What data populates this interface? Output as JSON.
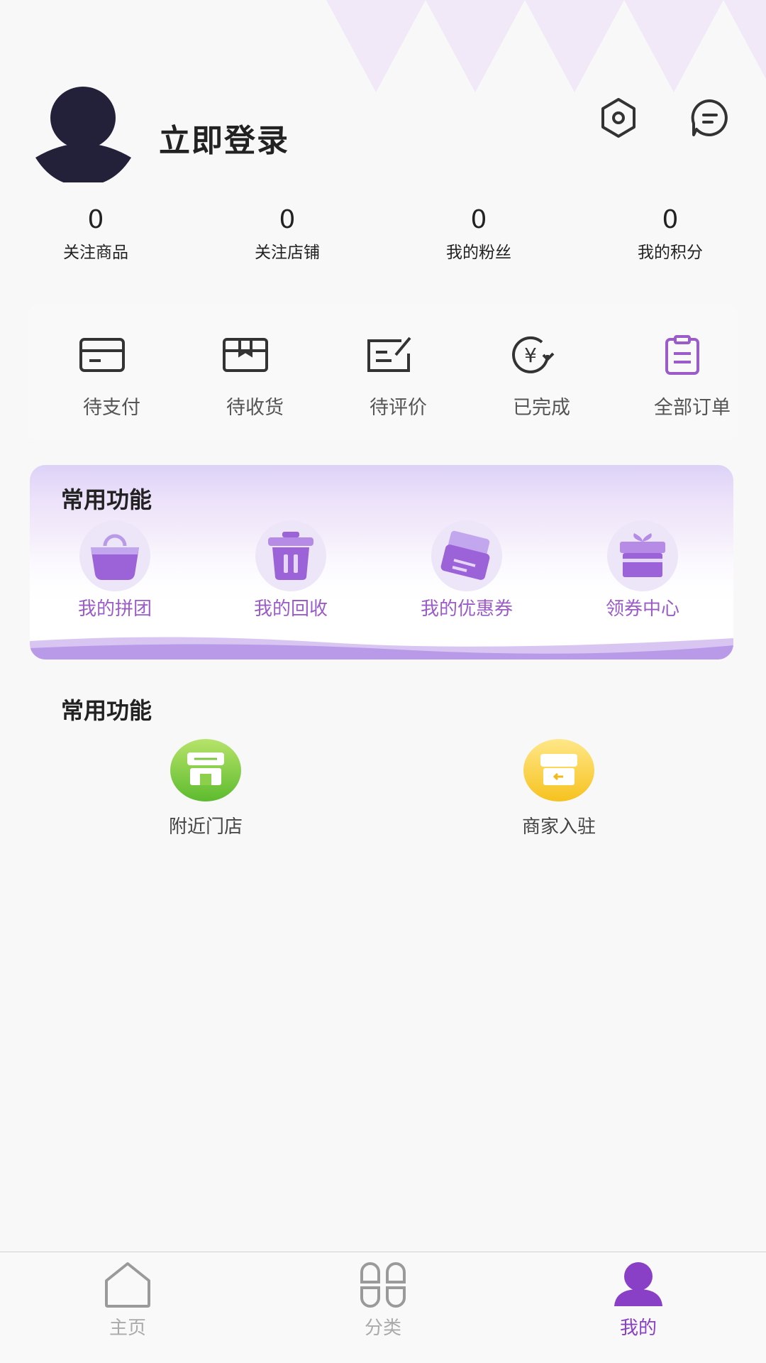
{
  "header": {
    "login_text": "立即登录",
    "settings_icon": "hexagon-settings-icon",
    "message_icon": "chat-bubble-icon"
  },
  "stats": [
    {
      "value": "0",
      "label": "关注商品"
    },
    {
      "value": "0",
      "label": "关注店铺"
    },
    {
      "value": "0",
      "label": "我的粉丝"
    },
    {
      "value": "0",
      "label": "我的积分"
    }
  ],
  "orders": [
    {
      "label": "待支付",
      "icon": "card-icon"
    },
    {
      "label": "待收货",
      "icon": "box-icon"
    },
    {
      "label": "待评价",
      "icon": "review-icon"
    },
    {
      "label": "已完成",
      "icon": "yen-refresh-icon"
    },
    {
      "label": "全部订单",
      "icon": "clipboard-icon"
    }
  ],
  "functions": {
    "title": "常用功能",
    "items": [
      {
        "label": "我的拼团",
        "icon": "shopping-bag-icon"
      },
      {
        "label": "我的回收",
        "icon": "trash-bin-icon"
      },
      {
        "label": "我的优惠券",
        "icon": "coupon-icon"
      },
      {
        "label": "领券中心",
        "icon": "gift-icon"
      }
    ]
  },
  "functions2": {
    "title": "常用功能",
    "items": [
      {
        "label": "附近门店",
        "icon": "green-store-icon"
      },
      {
        "label": "商家入驻",
        "icon": "yellow-store-icon"
      }
    ]
  },
  "tabbar": [
    {
      "label": "主页",
      "icon": "home-icon",
      "active": false
    },
    {
      "label": "分类",
      "icon": "category-icon",
      "active": false
    },
    {
      "label": "我的",
      "icon": "user-icon",
      "active": true
    }
  ],
  "colors": {
    "accent": "#8a3fc7",
    "accent_light": "#9b5cc9",
    "order_icon_active": "#9b5cc9"
  }
}
